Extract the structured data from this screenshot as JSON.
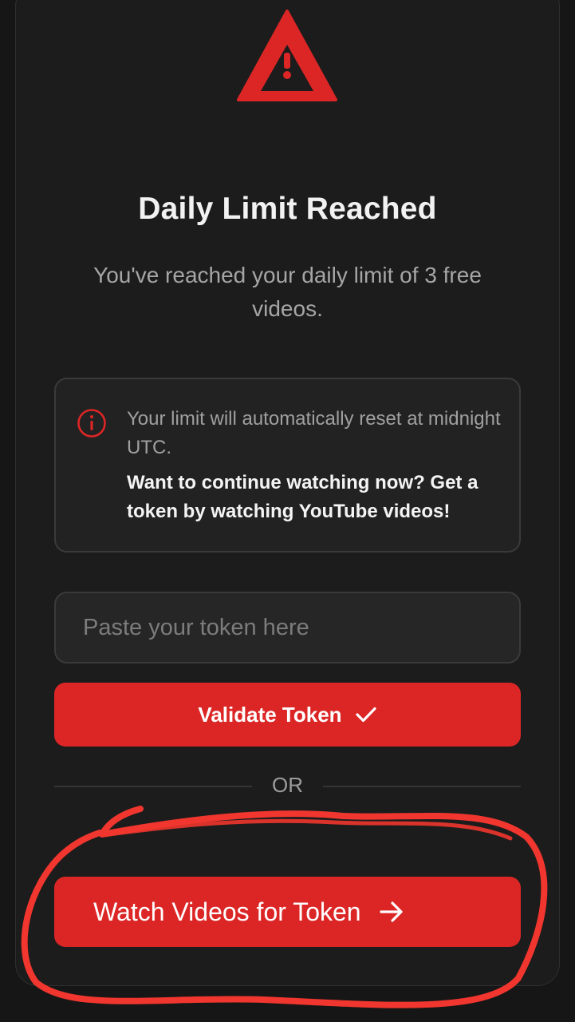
{
  "alert": {
    "icon": "warning-triangle-icon",
    "title": "Daily Limit Reached",
    "message": "You've reached your daily limit of 3 free videos."
  },
  "info": {
    "icon": "info-circle-icon",
    "reset_text": "Your limit will automatically reset at midnight UTC.",
    "cta_text": "Want to continue watching now? Get a token by watching YouTube videos!"
  },
  "token": {
    "placeholder": "Paste your token here",
    "value": ""
  },
  "validate_button": {
    "label": "Validate Token",
    "icon": "checkmark-icon"
  },
  "divider": {
    "label": "OR"
  },
  "watch_button": {
    "label": "Watch Videos for Token",
    "icon": "arrow-right-icon"
  },
  "colors": {
    "accent": "#dc2626",
    "background": "#1c1c1c",
    "annotation": "#f0362e"
  }
}
